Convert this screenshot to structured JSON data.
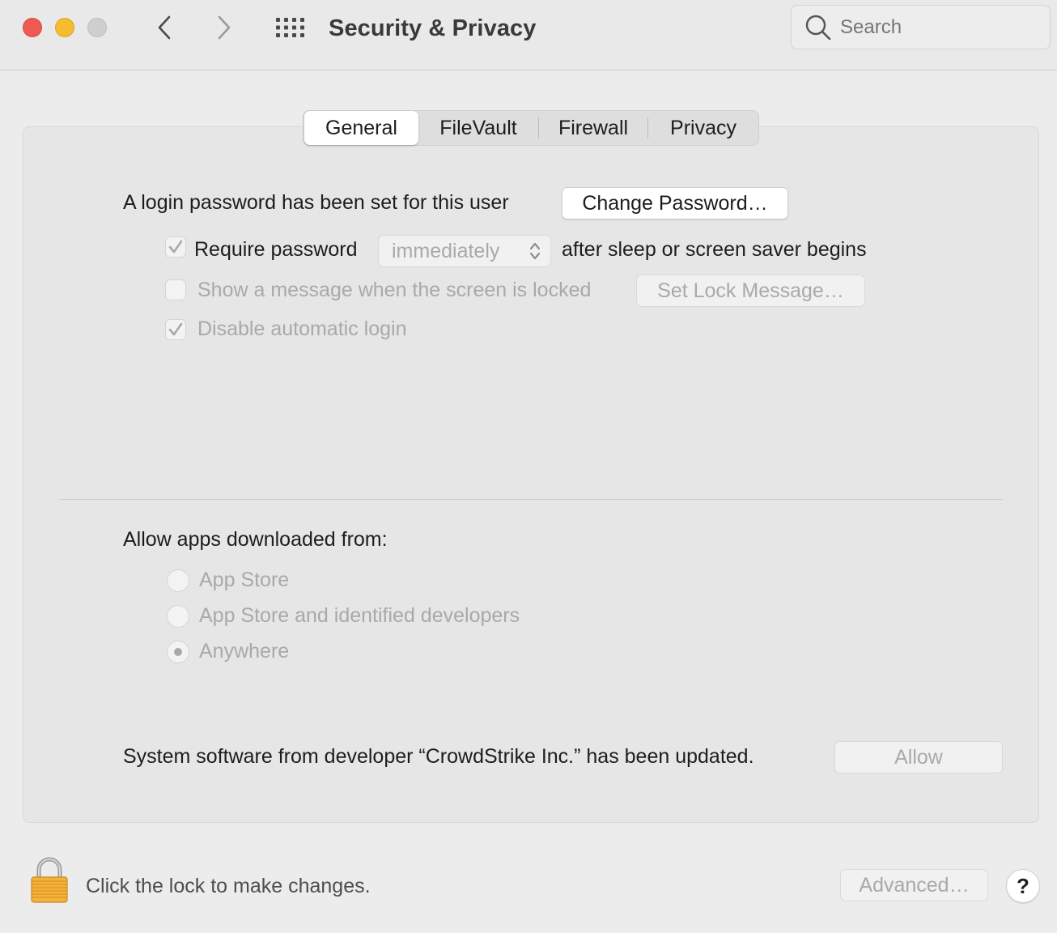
{
  "window": {
    "title": "Security & Privacy",
    "search_placeholder": "Search"
  },
  "tabs": [
    {
      "label": "General",
      "selected": true
    },
    {
      "label": "FileVault",
      "selected": false
    },
    {
      "label": "Firewall",
      "selected": false
    },
    {
      "label": "Privacy",
      "selected": false
    }
  ],
  "general": {
    "login_password_text": "A login password has been set for this user",
    "change_password_label": "Change Password…",
    "require_password": {
      "checked": true,
      "label": "Require password",
      "popup_value": "immediately",
      "suffix": "after sleep or screen saver begins"
    },
    "show_message": {
      "checked": false,
      "label": "Show a message when the screen is locked",
      "button_label": "Set Lock Message…"
    },
    "disable_auto_login": {
      "checked": true,
      "label": "Disable automatic login"
    }
  },
  "apps": {
    "heading": "Allow apps downloaded from:",
    "options": [
      {
        "label": "App Store",
        "selected": false
      },
      {
        "label": "App Store and identified developers",
        "selected": false
      },
      {
        "label": "Anywhere",
        "selected": true
      }
    ]
  },
  "system_software": {
    "text": "System software from developer “CrowdStrike Inc.” has been updated.",
    "allow_label": "Allow"
  },
  "footer": {
    "lock_text": "Click the lock to make changes.",
    "advanced_label": "Advanced…",
    "help_label": "?"
  },
  "colors": {
    "close": "#ee5a52",
    "minimize": "#f5bc2f",
    "zoom_disabled": "#cfcfcf",
    "lock_gold": "#f3b23c"
  },
  "icons": [
    "back-chevron-icon",
    "forward-chevron-icon",
    "grid-icon",
    "search-icon",
    "checkmark-icon",
    "popup-arrows-icon",
    "lock-icon"
  ]
}
